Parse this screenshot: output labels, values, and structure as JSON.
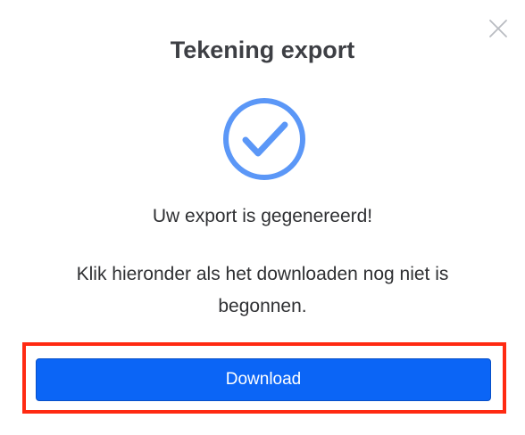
{
  "dialog": {
    "title": "Tekening export",
    "close_icon": "close-icon",
    "status_icon": "check-circle-icon",
    "message": "Uw export is gegenereerd!",
    "instruction": "Klik hieronder als het downloaden nog niet is begonnen.",
    "download_label": "Download"
  },
  "colors": {
    "accent": "#0b65f6",
    "check": "#5b97f7",
    "highlight": "#ff2a12",
    "title": "#3d3f44",
    "text": "#2f3033",
    "close": "#b9bcc2"
  }
}
